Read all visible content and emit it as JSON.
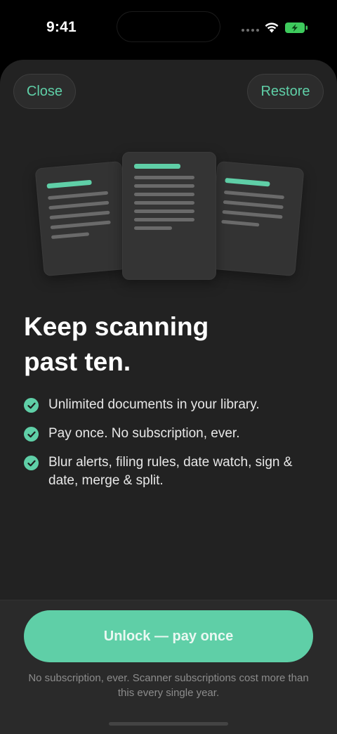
{
  "status_bar": {
    "time": "9:41",
    "icons": [
      "cellular-icon",
      "wifi-icon",
      "battery-charging-icon"
    ]
  },
  "nav": {
    "close_label": "Close",
    "restore_label": "Restore"
  },
  "illustration": {
    "description_icons": [
      "document-icon",
      "document-icon",
      "document-icon"
    ]
  },
  "headline": {
    "line1": "Keep scanning",
    "line2": "past ten."
  },
  "features": [
    "Unlimited documents in your library.",
    "Pay once. No subscription, ever.",
    "Blur alerts, filing rules, date watch, sign & date, merge & split."
  ],
  "cta": {
    "label": "Unlock — pay once",
    "footnote": "No subscription, ever. Scanner subscriptions cost more than this every single year."
  },
  "colors": {
    "accent": "#5fcfa7",
    "sheet_background": "#222222",
    "panel_background": "#2a2a2a"
  }
}
